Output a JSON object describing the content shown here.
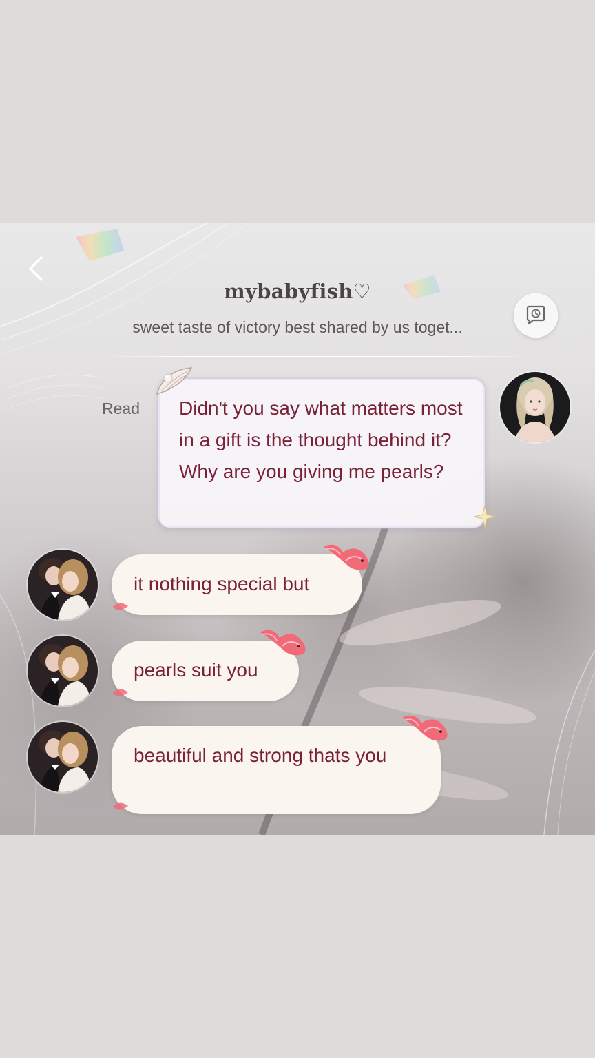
{
  "header": {
    "title": "mybabyfish♡",
    "subtitle": "sweet taste of victory best shared by us toget..."
  },
  "icons": {
    "back": "chevron-left-icon",
    "history": "chat-history-icon"
  },
  "messages": [
    {
      "side": "incoming",
      "status": "Read",
      "text": "Didn't you say what matters most in a gift is the thought behind it? Why are you giving me pearls?"
    },
    {
      "side": "outgoing",
      "text": "it nothing special but"
    },
    {
      "side": "outgoing",
      "text": "pearls suit you"
    },
    {
      "side": "outgoing",
      "text": "beautiful and strong thats you"
    }
  ],
  "colors": {
    "message_text": "#7a2135",
    "outgoing_bubble": "#fbf5ef",
    "incoming_bubble": "#f7f5f9",
    "fish_accent": "#e8536a"
  }
}
